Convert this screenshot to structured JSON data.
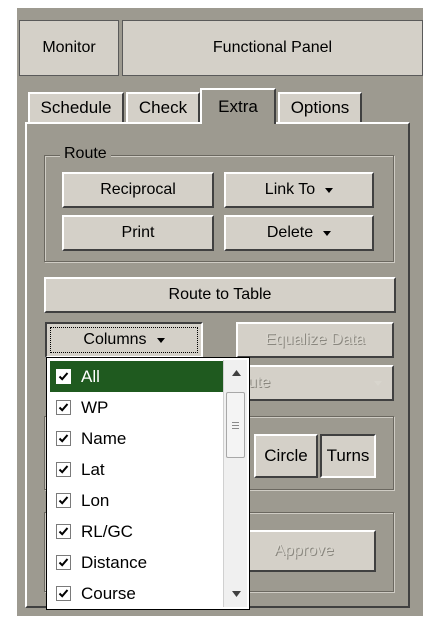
{
  "header": {
    "monitor_label": "Monitor",
    "panel_title": "Functional Panel"
  },
  "tabs": [
    {
      "label": "Schedule",
      "active": false
    },
    {
      "label": "Check",
      "active": false
    },
    {
      "label": "Extra",
      "active": true
    },
    {
      "label": "Options",
      "active": false
    }
  ],
  "route_group": {
    "title": "Route",
    "reciprocal": "Reciprocal",
    "link_to": "Link To",
    "print": "Print",
    "delete": "Delete"
  },
  "route_to_table": "Route to Table",
  "columns_button": "Columns",
  "equalize_data": "Equalize Data",
  "hidden_combo_text": "ute",
  "toggles": {
    "circle": "Circle",
    "turns": "Turns"
  },
  "approve": "Approve",
  "columns_list": [
    {
      "label": "All",
      "checked": true,
      "selected": true
    },
    {
      "label": "WP",
      "checked": true,
      "selected": false
    },
    {
      "label": "Name",
      "checked": true,
      "selected": false
    },
    {
      "label": "Lat",
      "checked": true,
      "selected": false
    },
    {
      "label": "Lon",
      "checked": true,
      "selected": false
    },
    {
      "label": "RL/GC",
      "checked": true,
      "selected": false
    },
    {
      "label": "Distance",
      "checked": true,
      "selected": false
    },
    {
      "label": "Course",
      "checked": true,
      "selected": false
    }
  ],
  "colors": {
    "panel_bg": "#9d9a90",
    "button_face": "#d4d0c8",
    "selection": "#1f5a1f"
  },
  "icons": {
    "dropdown_arrow": "chevron-down-icon",
    "checkbox": "checkmark-icon",
    "scroll_up": "scroll-up-icon",
    "scroll_down": "scroll-down-icon"
  }
}
